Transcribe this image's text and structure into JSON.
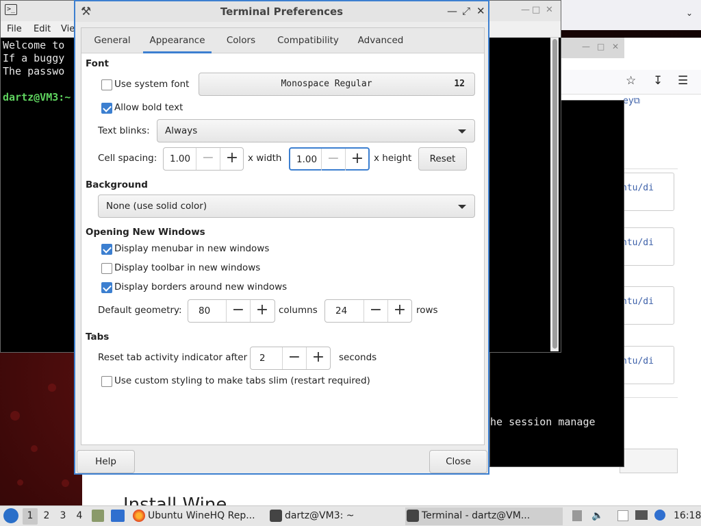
{
  "terminal_bg": {
    "menubar": [
      "File",
      "Edit",
      "Vie"
    ],
    "lines": [
      "Welcome to",
      "If a buggy",
      "The passwo"
    ],
    "prompt": "dartz@VM3:~"
  },
  "terminal2": {
    "text": "he session manage"
  },
  "browser": {
    "link_fragment": "ey⧉",
    "list_items": [
      "ntu/di",
      "ntu/di",
      "ntu/di",
      "ntu/di"
    ],
    "heading": "Install Wine"
  },
  "dialog": {
    "title": "Terminal Preferences",
    "tabs": [
      "General",
      "Appearance",
      "Colors",
      "Compatibility",
      "Advanced"
    ],
    "active_tab": "Appearance",
    "font": {
      "section": "Font",
      "use_system_font": {
        "label": "Use system font",
        "checked": false
      },
      "font_name": "Monospace Regular",
      "font_size": "12",
      "allow_bold": {
        "label": "Allow bold text",
        "checked": true
      },
      "text_blinks_label": "Text blinks:",
      "text_blinks_value": "Always",
      "cell_spacing_label": "Cell spacing:",
      "width_value": "1.00",
      "width_suffix": "x width",
      "height_value": "1.00",
      "height_suffix": "x height",
      "reset_label": "Reset"
    },
    "background": {
      "section": "Background",
      "value": "None (use solid color)"
    },
    "new_windows": {
      "section": "Opening New Windows",
      "menubar": {
        "label": "Display menubar in new windows",
        "checked": true
      },
      "toolbar": {
        "label": "Display toolbar in new windows",
        "checked": false
      },
      "borders": {
        "label": "Display borders around new windows",
        "checked": true
      },
      "geometry_label": "Default geometry:",
      "columns_value": "80",
      "columns_suffix": "columns",
      "rows_value": "24",
      "rows_suffix": "rows"
    },
    "tabs_section": {
      "section": "Tabs",
      "reset_activity_label": "Reset tab activity indicator after",
      "reset_activity_value": "2",
      "seconds_label": "seconds",
      "slim_tabs": {
        "label": "Use custom styling to make tabs slim (restart required)",
        "checked": false
      }
    },
    "help_label": "Help",
    "close_label": "Close"
  },
  "taskbar": {
    "workspaces": [
      "1",
      "2",
      "3",
      "4"
    ],
    "active_workspace": "1",
    "tasks": [
      {
        "label": "Ubuntu WineHQ Rep...",
        "icon": "firefox-icon"
      },
      {
        "label": "dartz@VM3: ~",
        "icon": "terminal-icon"
      },
      {
        "label": "Terminal - dartz@VM...",
        "icon": "terminal-icon"
      }
    ],
    "clock": "16:18"
  },
  "colors": {
    "accent": "#3c7fd0",
    "prompt_green": "#5fd35f"
  }
}
